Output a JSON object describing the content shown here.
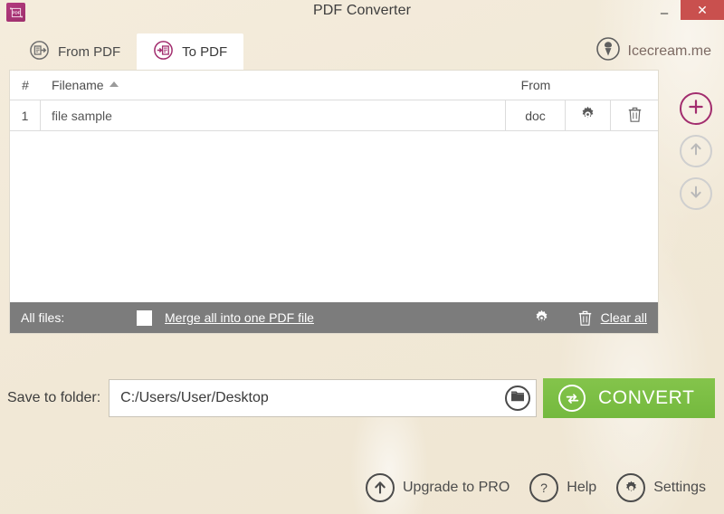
{
  "window": {
    "title": "PDF Converter",
    "app_icon": "pdf-app-icon",
    "minimize_label": "–",
    "close_label": "✕",
    "close_color": "#c9504e",
    "background_color": "#f1e8d6"
  },
  "brand": {
    "label": "Icecream.me",
    "icon": "ice-cream-cone-icon"
  },
  "tabs": [
    {
      "id": "from-pdf",
      "label": "From PDF",
      "icon": "from-pdf-icon",
      "active": false
    },
    {
      "id": "to-pdf",
      "label": "To PDF",
      "icon": "to-pdf-icon",
      "active": true
    }
  ],
  "file_table": {
    "columns": {
      "number": "#",
      "filename": "Filename",
      "from": "From",
      "sort_indicator": "ascending"
    },
    "rows": [
      {
        "number": "1",
        "filename": "file sample",
        "from": "doc",
        "settings_icon": "gear-icon",
        "delete_icon": "trash-icon"
      }
    ]
  },
  "side_actions": [
    {
      "id": "add-files",
      "icon": "plus-icon",
      "style": "primary"
    },
    {
      "id": "move-up",
      "icon": "arrow-up-icon",
      "style": "ghost"
    },
    {
      "id": "move-down",
      "icon": "arrow-down-icon",
      "style": "ghost"
    }
  ],
  "panel_footer": {
    "all_files_label": "All files:",
    "merge_label": "Merge all into one PDF file",
    "merge_checked": false,
    "settings_icon": "gear-icon",
    "trash_icon": "trash-icon",
    "clear_all_label": "Clear all",
    "background_color": "#7c7c7c"
  },
  "save_row": {
    "label": "Save to folder:",
    "path_value": "C:/Users/User/Desktop",
    "path_placeholder": "Select output folder",
    "browse_icon": "folder-icon"
  },
  "convert": {
    "label": "CONVERT",
    "icon": "convert-refresh-icon",
    "color": "#79bd42"
  },
  "bottom_bar": [
    {
      "id": "upgrade-to-pro",
      "label": "Upgrade to PRO",
      "icon": "arrow-up-icon"
    },
    {
      "id": "help",
      "label": "Help",
      "icon": "question-mark-icon"
    },
    {
      "id": "settings",
      "label": "Settings",
      "icon": "gear-icon"
    }
  ]
}
